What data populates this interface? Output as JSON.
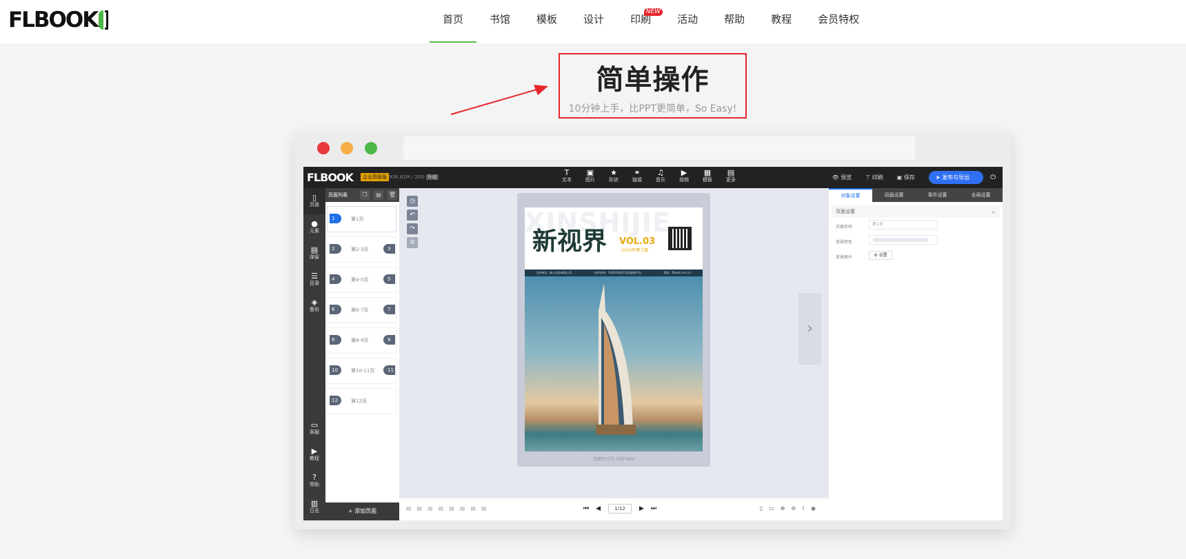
{
  "logo": {
    "text": "FLBOOK"
  },
  "nav": {
    "items": [
      {
        "label": "首页"
      },
      {
        "label": "书馆"
      },
      {
        "label": "模板"
      },
      {
        "label": "设计"
      },
      {
        "label": "印刷",
        "badge": "NEW"
      },
      {
        "label": "活动"
      },
      {
        "label": "帮助"
      },
      {
        "label": "教程"
      },
      {
        "label": "会员特权"
      }
    ],
    "active_index": 0
  },
  "hero": {
    "title": "简单操作",
    "subtitle": "10分钟上手，比PPT更简单，So Easy!"
  },
  "editor": {
    "logo": "FLBOOK",
    "edition_badge": "企业高级版",
    "quota": "936.81M / 20G",
    "quota_tag": "升级",
    "tools": [
      {
        "label": "文本",
        "icon": "T"
      },
      {
        "label": "图片",
        "icon": "▣"
      },
      {
        "label": "形状",
        "icon": "★"
      },
      {
        "label": "链接",
        "icon": "⚭"
      },
      {
        "label": "音乐",
        "icon": "♫"
      },
      {
        "label": "视频",
        "icon": "▶"
      },
      {
        "label": "模板",
        "icon": "▦"
      },
      {
        "label": "更多",
        "icon": "▤"
      }
    ],
    "right_actions": {
      "preview": "预览",
      "print": "印刷",
      "save": "保存",
      "publish": "发布与导出"
    },
    "left_menu": [
      {
        "label": "页面",
        "icon": "▯"
      },
      {
        "label": "元素",
        "icon": "●"
      },
      {
        "label": "弹窗",
        "icon": "▤"
      },
      {
        "label": "目录",
        "icon": "☰"
      },
      {
        "label": "备份",
        "icon": "◈"
      }
    ],
    "left_menu_bottom": [
      {
        "label": "客服",
        "icon": "▭"
      },
      {
        "label": "教程",
        "icon": "▶"
      },
      {
        "label": "帮助",
        "icon": "?"
      },
      {
        "label": "日志",
        "icon": "▥"
      }
    ],
    "pages_panel": {
      "title": "页面列表",
      "pages": [
        {
          "num": "1",
          "label": "第1页",
          "num2": ""
        },
        {
          "num": "2",
          "label": "第2-3页",
          "num2": "3"
        },
        {
          "num": "4",
          "label": "第4-5页",
          "num2": "5"
        },
        {
          "num": "6",
          "label": "第6-7页",
          "num2": "7"
        },
        {
          "num": "8",
          "label": "第8-9页",
          "num2": "9"
        },
        {
          "num": "10",
          "label": "第10-11页",
          "num2": "11"
        },
        {
          "num": "12",
          "label": "第12页",
          "num2": ""
        }
      ],
      "add_page": "+ 添加页面"
    },
    "document": {
      "ghost_text": "XINSHIJIE",
      "title": "新视界",
      "volume": "VOL.03",
      "volume_sub": "2020年第三期",
      "strip": [
        "主办单位：新士业务有限公司",
        "技术支持：FLBOOK电子活动画册平台",
        "网址：flbook.com.cn"
      ],
      "caption": "页面尺寸为: 595*842"
    },
    "pager": {
      "current": "1/12"
    },
    "props": {
      "tabs": [
        "对象设置",
        "动画设置",
        "事件设置",
        "全局设置"
      ],
      "section": "页面设置",
      "page_name_label": "页面名称",
      "page_name_value": "第1页",
      "bg_color_label": "背景颜色",
      "bg_image_label": "背景图片",
      "bg_image_button": "设置"
    }
  },
  "colors": {
    "accent_green": "#4db848",
    "highlight_red": "#e8252b",
    "editor_blue": "#2f6ff3"
  }
}
